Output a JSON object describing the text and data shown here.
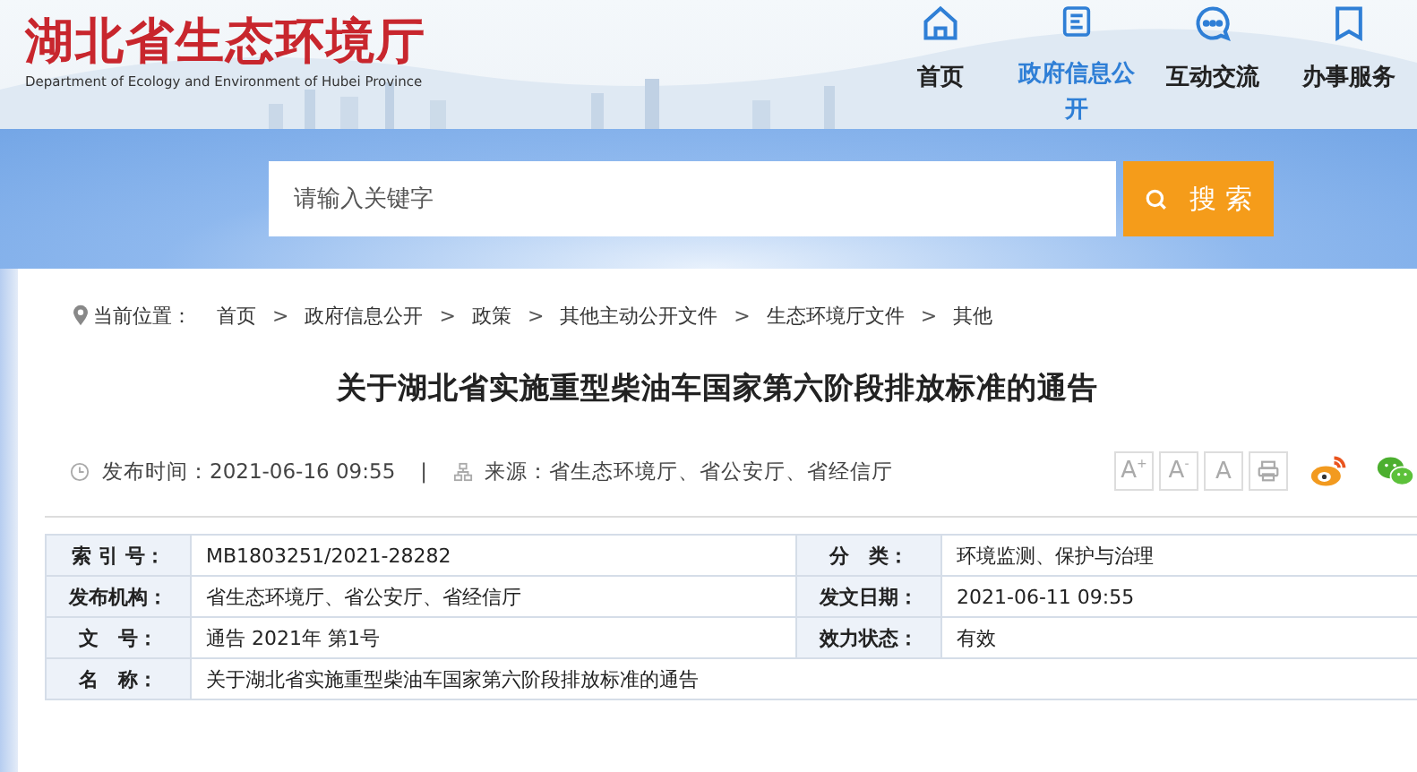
{
  "header": {
    "logo_title": "湖北省生态环境厅",
    "logo_subtitle": "Department of Ecology and Environment of Hubei Province",
    "nav": [
      {
        "label": "首页",
        "kind": "home",
        "selected": false
      },
      {
        "label": "政府信息公开",
        "kind": "document",
        "selected": true
      },
      {
        "label": "互动交流",
        "kind": "chat",
        "selected": false
      },
      {
        "label": "办事服务",
        "kind": "bookmark",
        "selected": false
      }
    ]
  },
  "search": {
    "placeholder": "请输入关键字",
    "button": "搜 索"
  },
  "breadcrumb": {
    "label": "当前位置：",
    "items": [
      "首页",
      "政府信息公开",
      "政策",
      "其他主动公开文件",
      "生态环境厅文件",
      "其他"
    ],
    "separator": ">"
  },
  "article": {
    "title": "关于湖北省实施重型柴油车国家第六阶段排放标准的通告",
    "published": "发布时间：2021-06-16 09:55",
    "divider": "|",
    "source": "来源：省生态环境厅、省公安厅、省经信厅",
    "font_buttons": [
      {
        "label": "A$^{+}$",
        "kind": "text"
      },
      {
        "label": "A$^{-}$",
        "kind": "text"
      },
      {
        "label": "A",
        "kind": "text"
      },
      {
        "kind": "print"
      }
    ],
    "share": [
      {
        "kind": "weibo"
      },
      {
        "kind": "wechat"
      }
    ]
  },
  "info_table": {
    "rows": [
      {
        "label": "索 引 号：",
        "value": "MB1803251/2021-28282",
        "label_2": "分　类：",
        "value_2": "环境监测、保护与治理"
      },
      {
        "label": "发布机构：",
        "value": "省生态环境厅、省公安厅、省经信厅",
        "label_2": "发文日期：",
        "value_2": "2021-06-11 09:55"
      },
      {
        "label": "文　号：",
        "value": "通告 2021年 第1号",
        "label_2": "效力状态：",
        "value_2": "有效"
      },
      {
        "label": "名　称：",
        "value": "关于湖北省实施重型柴油车国家第六阶段排放标准的通告"
      }
    ]
  }
}
